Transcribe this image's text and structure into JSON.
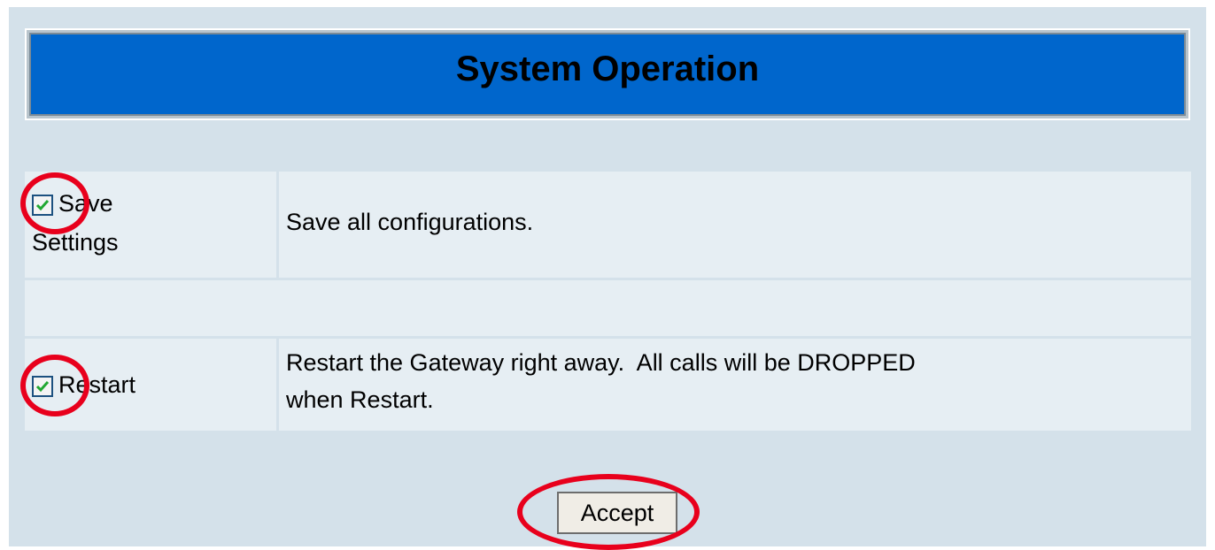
{
  "title": "System Operation",
  "options": [
    {
      "label": "Save Settings",
      "label_line1": "Save",
      "label_line2": "Settings",
      "description": "Save all configurations.",
      "checked": true
    },
    {
      "label": "Restart",
      "description_line1": "Restart the Gateway right away.  All calls will be DROPPED",
      "description_line2": "when Restart.",
      "checked": true
    }
  ],
  "accept_label": "Accept",
  "colors": {
    "page_background": "#d4e1ea",
    "title_background": "#0066cc",
    "cell_background": "#e6eef3",
    "annotation_ring": "#e8001c",
    "checkmark": "#22a832"
  },
  "icons": {
    "checkbox_checked": "check-icon",
    "annotation": "red-circle-highlight"
  }
}
